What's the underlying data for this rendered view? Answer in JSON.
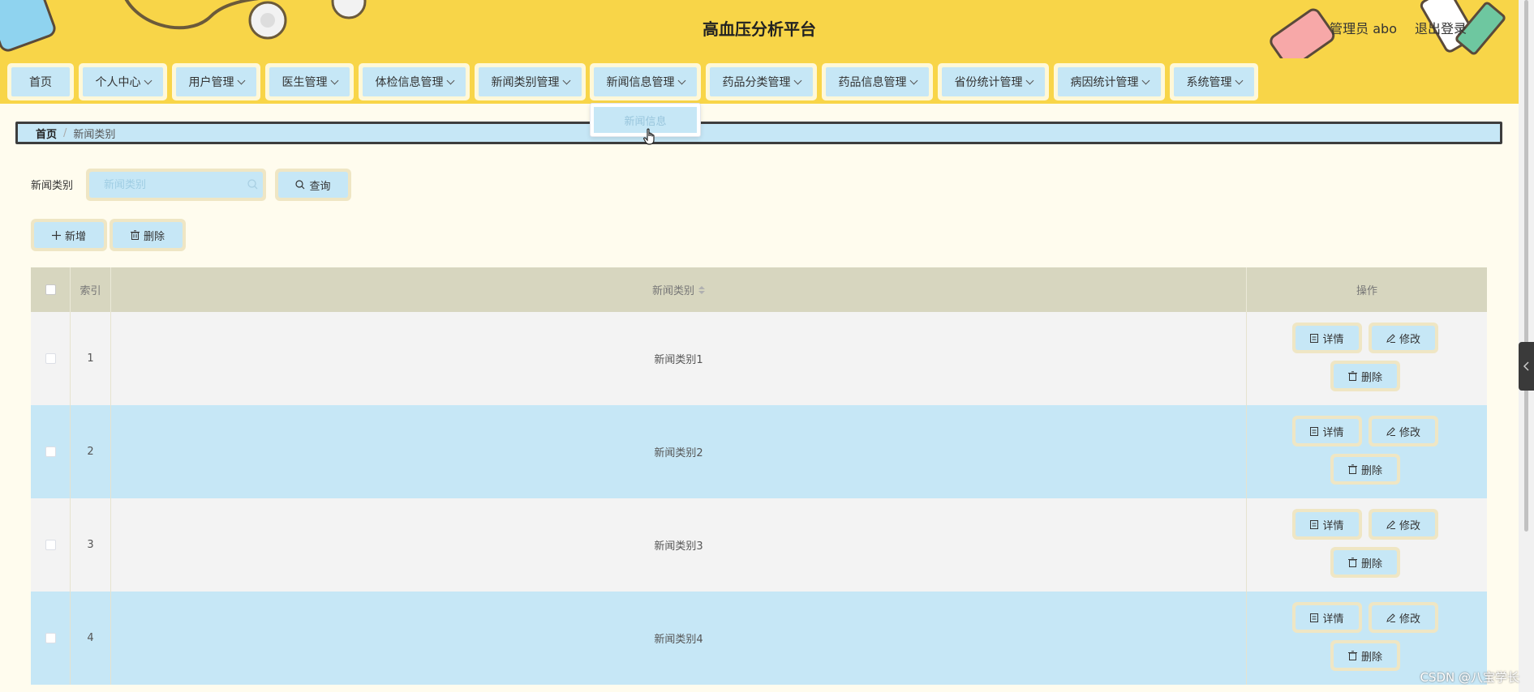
{
  "header": {
    "title": "高血压分析平台",
    "user_label": "管理员 abo",
    "logout_label": "退出登录"
  },
  "nav": {
    "items": [
      {
        "label": "首页",
        "has_dropdown": false
      },
      {
        "label": "个人中心",
        "has_dropdown": true
      },
      {
        "label": "用户管理",
        "has_dropdown": true
      },
      {
        "label": "医生管理",
        "has_dropdown": true
      },
      {
        "label": "体检信息管理",
        "has_dropdown": true
      },
      {
        "label": "新闻类别管理",
        "has_dropdown": true
      },
      {
        "label": "新闻信息管理",
        "has_dropdown": true
      },
      {
        "label": "药品分类管理",
        "has_dropdown": true
      },
      {
        "label": "药品信息管理",
        "has_dropdown": true
      },
      {
        "label": "省份统计管理",
        "has_dropdown": true
      },
      {
        "label": "病因统计管理",
        "has_dropdown": true
      },
      {
        "label": "系统管理",
        "has_dropdown": true
      }
    ],
    "open_dropdown": {
      "items": [
        "新闻信息"
      ]
    }
  },
  "breadcrumb": {
    "home": "首页",
    "separator": "/",
    "current": "新闻类别"
  },
  "search": {
    "label": "新闻类别",
    "placeholder": "新闻类别",
    "query_button": "查询"
  },
  "toolbar": {
    "add_label": "新增",
    "delete_label": "删除"
  },
  "table": {
    "columns": {
      "index": "索引",
      "name": "新闻类别",
      "ops": "操作"
    },
    "rows": [
      {
        "index": "1",
        "name": "新闻类别1"
      },
      {
        "index": "2",
        "name": "新闻类别2"
      },
      {
        "index": "3",
        "name": "新闻类别3"
      },
      {
        "index": "4",
        "name": "新闻类别4"
      }
    ],
    "row_actions": {
      "detail": "详情",
      "edit": "修改",
      "delete": "删除"
    }
  },
  "watermark": "CSDN @八宝学长",
  "colors": {
    "header_bg": "#f8d548",
    "button_bg": "#c6e7f6",
    "button_frame": "#efe6c4",
    "page_bg": "#fffcee",
    "table_header_bg": "#d7d6bf",
    "row_alt_bg": "#f3f3f3"
  }
}
